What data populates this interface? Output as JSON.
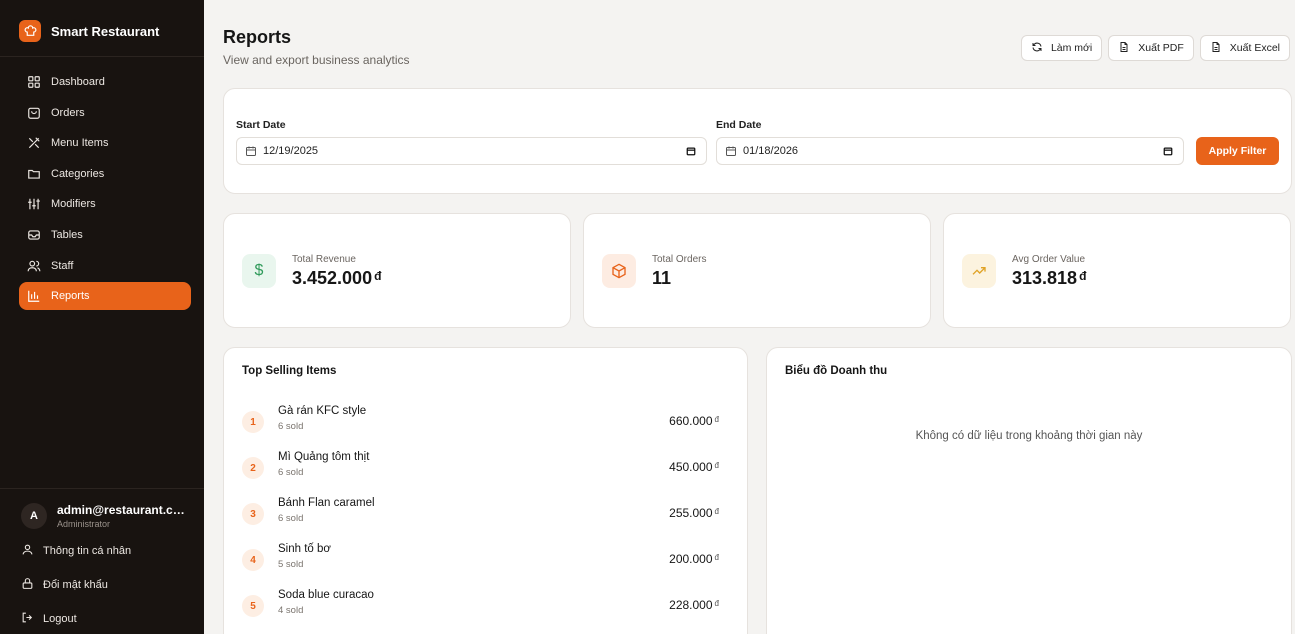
{
  "app": {
    "name": "Smart Restaurant"
  },
  "sidebar": {
    "items": [
      {
        "label": "Dashboard",
        "icon": "grid-icon"
      },
      {
        "label": "Orders",
        "icon": "bag-icon"
      },
      {
        "label": "Menu Items",
        "icon": "utensils-icon"
      },
      {
        "label": "Categories",
        "icon": "folder-icon"
      },
      {
        "label": "Modifiers",
        "icon": "sliders-icon"
      },
      {
        "label": "Tables",
        "icon": "table-icon"
      },
      {
        "label": "Staff",
        "icon": "users-icon"
      },
      {
        "label": "Reports",
        "icon": "bar-chart-icon",
        "active": true
      }
    ]
  },
  "user": {
    "avatar_letter": "A",
    "email": "admin@restaurant.co...",
    "role": "Administrator",
    "profile_label": "Thông tin cá nhân",
    "password_label": "Đổi mật khẩu",
    "logout_label": "Logout"
  },
  "header": {
    "title": "Reports",
    "subtitle": "View and export business analytics",
    "refresh_label": "Làm mới",
    "pdf_label": "Xuất PDF",
    "excel_label": "Xuất Excel"
  },
  "filter": {
    "start_label": "Start Date",
    "start_value": "12/19/2025",
    "end_label": "End Date",
    "end_value": "01/18/2026",
    "apply_label": "Apply Filter"
  },
  "stats": {
    "revenue": {
      "label": "Total Revenue",
      "value": "3.452.000",
      "currency": "đ",
      "color": "#2f9a5a"
    },
    "orders": {
      "label": "Total Orders",
      "value": "11",
      "color": "#e8631a"
    },
    "avg": {
      "label": "Avg Order Value",
      "value": "313.818",
      "currency": "đ",
      "color": "#e0a326"
    }
  },
  "top_selling": {
    "title": "Top Selling Items",
    "currency": "đ",
    "items": [
      {
        "rank": "1",
        "name": "Gà rán KFC style",
        "sold": "6 sold",
        "amount": "660.000"
      },
      {
        "rank": "2",
        "name": "Mì Quảng tôm thịt",
        "sold": "6 sold",
        "amount": "450.000"
      },
      {
        "rank": "3",
        "name": "Bánh Flan caramel",
        "sold": "6 sold",
        "amount": "255.000"
      },
      {
        "rank": "4",
        "name": "Sinh tố bơ",
        "sold": "5 sold",
        "amount": "200.000"
      },
      {
        "rank": "5",
        "name": "Soda blue curacao",
        "sold": "4 sold",
        "amount": "228.000"
      }
    ]
  },
  "revenue_chart": {
    "title": "Biểu đồ Doanh thu",
    "empty_message": "Không có dữ liệu trong khoảng thời gian này"
  }
}
